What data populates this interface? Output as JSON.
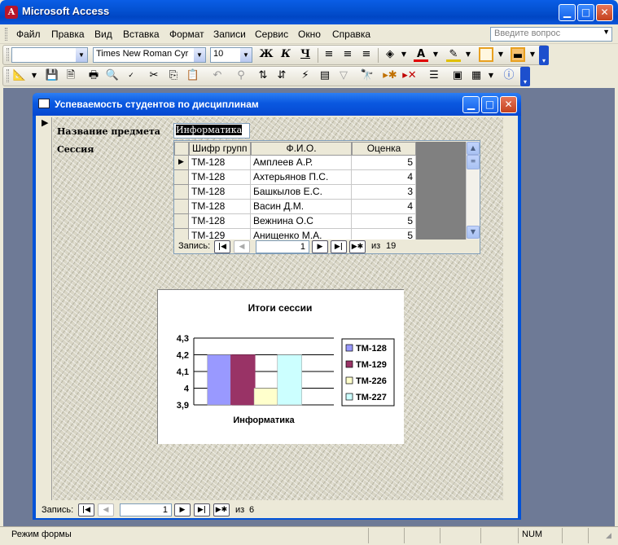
{
  "app": {
    "title": "Microsoft Access",
    "icon_letter": "A",
    "controls": [
      "minimize-icon",
      "maximize-icon",
      "close-icon"
    ]
  },
  "menu": {
    "items": [
      "Файл",
      "Правка",
      "Вид",
      "Вставка",
      "Формат",
      "Записи",
      "Сервис",
      "Окно",
      "Справка"
    ],
    "help_placeholder": "Введите вопрос"
  },
  "formatting_toolbar": {
    "object_combo": "",
    "font_name": "Times New Roman Cyr",
    "font_size": "10",
    "bold": "Ж",
    "italic": "К",
    "underline": "Ч"
  },
  "form": {
    "title": "Успеваемость студентов по дисциплинам",
    "subject_label": "Название предмета",
    "subject_value": "Информатика",
    "session_label": "Сессия",
    "grid": {
      "columns": [
        "Шифр групп",
        "Ф.И.О.",
        "Оценка"
      ],
      "rows": [
        [
          "ТМ-128",
          "Амплеев А.Р.",
          "5"
        ],
        [
          "ТМ-128",
          "Ахтерьянов П.С.",
          "4"
        ],
        [
          "ТМ-128",
          "Башкылов Е.С.",
          "3"
        ],
        [
          "ТМ-128",
          "Васин Д.М.",
          "4"
        ],
        [
          "ТМ-128",
          "Вежнина О.С",
          "5"
        ],
        [
          "ТМ-129",
          "Анищенко М.А.",
          "5"
        ]
      ],
      "current_row": 0
    },
    "sub_nav": {
      "label": "Запись:",
      "current": "1",
      "of_label": "из",
      "total": "19"
    },
    "main_nav": {
      "label": "Запись:",
      "current": "1",
      "of_label": "из",
      "total": "6"
    }
  },
  "chart_data": {
    "type": "bar",
    "title": "Итоги сессии",
    "xlabel": "Информатика",
    "ylabel": "",
    "categories": [
      "Информатика"
    ],
    "series": [
      {
        "name": "ТМ-128",
        "values": [
          4.2
        ],
        "color": "#9999ff"
      },
      {
        "name": "ТМ-129",
        "values": [
          4.2
        ],
        "color": "#993366"
      },
      {
        "name": "ТМ-226",
        "values": [
          4.0
        ],
        "color": "#ffffcc"
      },
      {
        "name": "ТМ-227",
        "values": [
          4.2
        ],
        "color": "#ccffff"
      }
    ],
    "ylim": [
      3.9,
      4.3
    ],
    "yticks": [
      "4,3",
      "4,2",
      "4,1",
      "4",
      "3,9"
    ],
    "grid": true,
    "legend": "right"
  },
  "status": {
    "mode": "Режим формы",
    "num": "NUM"
  }
}
